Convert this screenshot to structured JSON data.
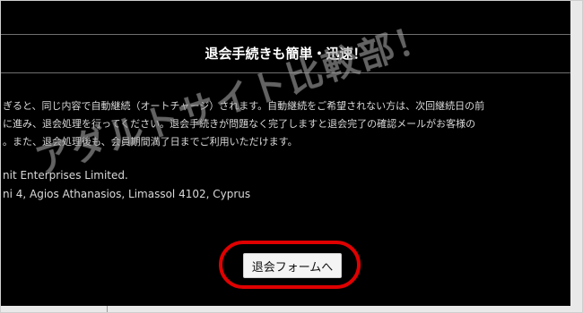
{
  "header": {
    "title": "退会手続きも簡単・迅速！"
  },
  "content": {
    "lines": [
      "ぎると、同じ内容で自動継続（オートチャージ）されます。自動継続をご希望されない方は、次回継続日の前",
      "に進み、退会処理を行ってください。退会手続きが問題なく完了しますと退会完了の確認メールがお客様の",
      "。また、退会処理後も、会員期間満了日までご利用いただけます。"
    ],
    "company_lines": [
      "nit Enterprises Limited.",
      "ni 4, Agios Athanasios, Limassol 4102, Cyprus"
    ]
  },
  "cta": {
    "label": "退会フォームへ"
  },
  "watermark": {
    "text": "アダルトサイト比較部！"
  },
  "colors": {
    "panel": "#000000",
    "highlight": "#e00000",
    "button": "#f4f4f4"
  }
}
